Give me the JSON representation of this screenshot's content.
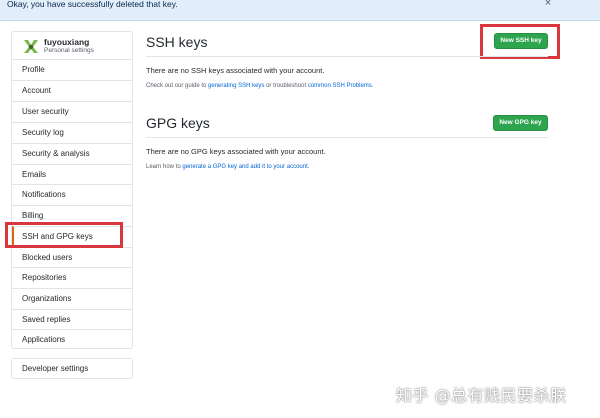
{
  "flash": {
    "message": "Okay, you have successfully deleted that key.",
    "close_icon": "×"
  },
  "profile": {
    "username": "fuyouxiang",
    "subtitle": "Personal settings"
  },
  "sidebar": {
    "items": [
      {
        "label": "Profile"
      },
      {
        "label": "Account"
      },
      {
        "label": "User security"
      },
      {
        "label": "Security log"
      },
      {
        "label": "Security & analysis"
      },
      {
        "label": "Emails"
      },
      {
        "label": "Notifications"
      },
      {
        "label": "Billing"
      },
      {
        "label": "SSH and GPG keys",
        "active": true
      },
      {
        "label": "Blocked users"
      },
      {
        "label": "Repositories"
      },
      {
        "label": "Organizations"
      },
      {
        "label": "Saved replies"
      },
      {
        "label": "Applications"
      }
    ],
    "developer_settings": "Developer settings"
  },
  "ssh": {
    "title": "SSH keys",
    "button": "New SSH key",
    "empty": "There are no SSH keys associated with your account.",
    "help_prefix": "Check out our guide to ",
    "help_link1": "generating SSH keys",
    "help_middle": " or troubleshoot ",
    "help_link2": "common SSH Problems",
    "help_suffix": "."
  },
  "gpg": {
    "title": "GPG keys",
    "button": "New GPG key",
    "empty": "There are no GPG keys associated with your account.",
    "help_prefix": "Learn how to ",
    "help_link1": "generate a GPG key and add it to your account",
    "help_suffix": "."
  },
  "watermark": "知乎 @总有贱民要杀朕",
  "colors": {
    "accent_green": "#2ea44f",
    "highlight_red": "#d9363e",
    "active_border": "#e36209",
    "flash_bg": "#e2eef9",
    "link": "#0366d6"
  }
}
